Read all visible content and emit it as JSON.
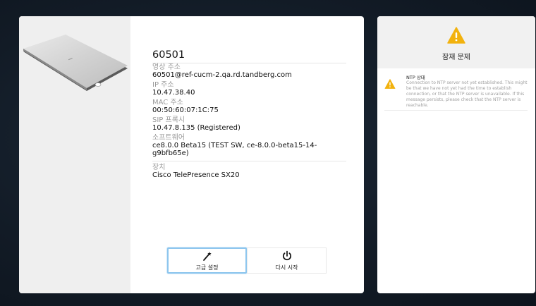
{
  "device": {
    "title": "60501",
    "fields": {
      "video_address_label": "영상 주소",
      "video_address": "60501@ref-cucm-2.qa.rd.tandberg.com",
      "ip_label": "IP 주소",
      "ip": "10.47.38.40",
      "mac_label": "MAC 주소",
      "mac": "00:50:60:07:1C:75",
      "sip_label": "SIP 프록시",
      "sip": "10.47.8.135 (Registered)",
      "software_label": "소프트웨어",
      "software": "ce8.0.0 Beta15 (TEST SW, ce-8.0.0-beta15-14-g9bfb65e)",
      "hardware_label": "장치",
      "hardware": "Cisco TelePresence SX20"
    }
  },
  "buttons": {
    "advanced_label": "고급 설정",
    "advanced_icon": "wand-icon",
    "restart_label": "다시 시작",
    "restart_icon": "power-icon"
  },
  "issues": {
    "title": "잠재 문제",
    "items": [
      {
        "title": "NTP 상태",
        "text": "Connection to NTP server not yet established. This might be that we have not yet had the time to establish connection, or that the NTP server is unavailable. If this message persists, please check that the NTP server is reachable."
      }
    ]
  },
  "colors": {
    "warning": "#f2b20e",
    "selected_border": "#8ec6ee",
    "background": "#121b26"
  }
}
